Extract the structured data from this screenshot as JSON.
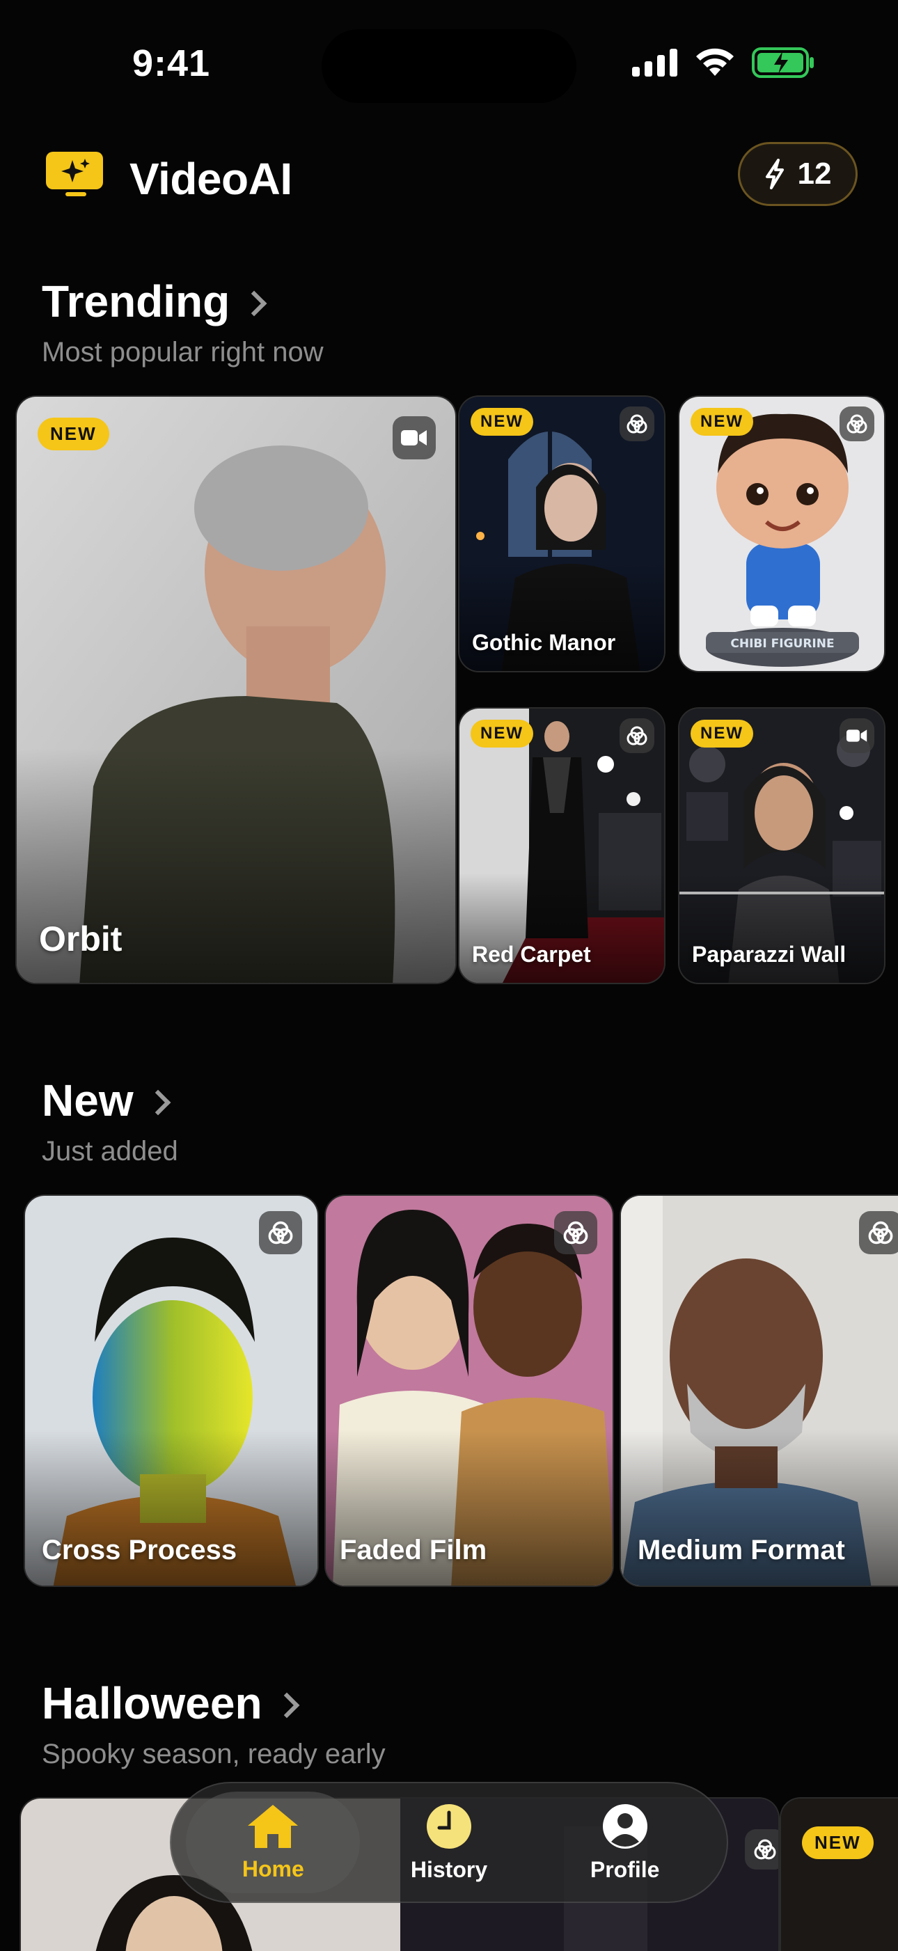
{
  "status_bar": {
    "time": "9:41"
  },
  "header": {
    "app_name": "VideoAI",
    "credits": "12"
  },
  "sections": {
    "trending": {
      "title": "Trending",
      "subtitle": "Most popular right now",
      "cards": [
        {
          "label": "Orbit",
          "badge": "NEW",
          "type_icon": "video-icon"
        },
        {
          "label": "Gothic Manor",
          "badge": "NEW",
          "type_icon": "photo-style-icon"
        },
        {
          "label": "",
          "badge": "NEW",
          "type_icon": "photo-style-icon",
          "caption_in_image": "CHIBI FIGURINE"
        },
        {
          "label": "Red Carpet",
          "badge": "NEW",
          "type_icon": "photo-style-icon"
        },
        {
          "label": "Paparazzi Wall",
          "badge": "NEW",
          "type_icon": "video-icon"
        }
      ]
    },
    "new": {
      "title": "New",
      "subtitle": "Just added",
      "cards": [
        {
          "label": "Cross Process",
          "type_icon": "photo-style-icon"
        },
        {
          "label": "Faded Film",
          "type_icon": "photo-style-icon"
        },
        {
          "label": "Medium Format",
          "type_icon": "photo-style-icon"
        }
      ]
    },
    "halloween": {
      "title": "Halloween",
      "subtitle": "Spooky season, ready early",
      "cards": [
        {
          "badge": "NEW"
        }
      ]
    }
  },
  "nav": {
    "items": [
      {
        "label": "Home",
        "icon": "home-icon",
        "active": true
      },
      {
        "label": "History",
        "icon": "clock-icon",
        "active": false
      },
      {
        "label": "Profile",
        "icon": "profile-icon",
        "active": false
      }
    ]
  },
  "colors": {
    "accent": "#f5c518",
    "background": "#050505",
    "battery": "#34c759"
  }
}
